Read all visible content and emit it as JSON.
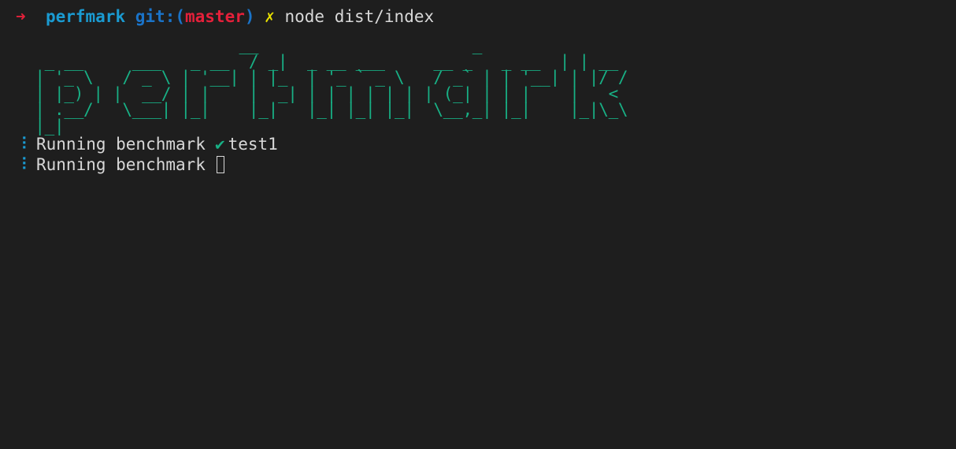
{
  "prompt": {
    "arrow": "➜",
    "directory": "perfmark",
    "git_label": "git:",
    "open_paren": "(",
    "branch": "master",
    "close_paren": ")",
    "dirty_marker": "✗",
    "command": "node dist/index"
  },
  "banner": {
    "ascii_lines": [
      "                      __                      _",
      "  _ __     ___   _ __  / _|  _ __ ___     __ _   _ __  | | __",
      " | '_ \\   / _ \\ | '__| | |_  | '_ ` _ \\   / _` | | '__| | |/ /",
      " | |_) | |  __/ | |    |  _| | | | | | | | (_| | | |    |   <",
      " | .__/   \\___| |_|    |_|   |_| |_| |_|  \\__,_| |_|    |_|\\_\\",
      " |_|"
    ]
  },
  "output": {
    "lines": [
      {
        "spinner": "⠸",
        "text": "Running benchmark",
        "status_icon": "✔",
        "test_name": "test1"
      },
      {
        "spinner": "⠸",
        "text": "Running benchmark"
      }
    ]
  },
  "colors": {
    "background": "#1e1e1e",
    "ascii_art": "#18b085",
    "arrow": "#e5203a",
    "directory": "#1a9bd2",
    "git": "#1a73c8",
    "branch": "#e5203a",
    "dirty": "#e8e000",
    "check": "#18b085"
  }
}
